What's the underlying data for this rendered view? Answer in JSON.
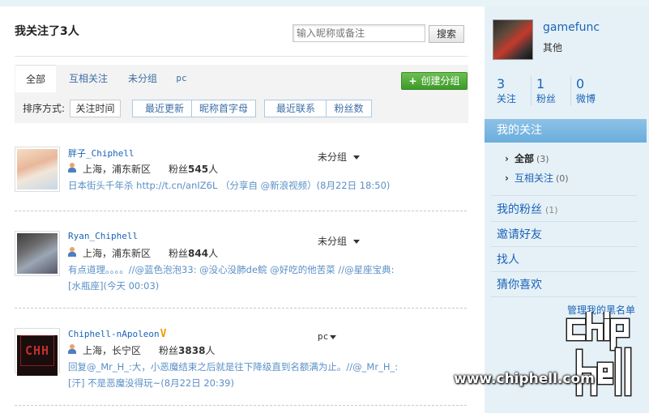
{
  "main": {
    "title": "我关注了3人",
    "search": {
      "placeholder": "输入昵称或备注",
      "button": "搜索"
    },
    "tabs": [
      {
        "label": "全部",
        "active": true
      },
      {
        "label": "互相关注"
      },
      {
        "label": "未分组"
      },
      {
        "label": "pc"
      }
    ],
    "create_group": "创建分组",
    "sort_label": "排序方式:",
    "sort_options": [
      "关注时间",
      "最近更新",
      "昵称首字母",
      "最近联系",
      "粉丝数"
    ],
    "users": [
      {
        "name": "胖子_Chiphell",
        "location": "上海，浦东新区",
        "fans_prefix": "粉丝",
        "fans_count": "545",
        "fans_suffix": "人",
        "group": "未分组",
        "status_line1": "日本街头千年杀 http://t.cn/anIZ6L （分享自 @新浪视频）(8月22日 18:50)",
        "status_line2": ""
      },
      {
        "name": "Ryan_Chiphell",
        "location": "上海，浦东新区",
        "fans_prefix": "粉丝",
        "fans_count": "844",
        "fans_suffix": "人",
        "group": "未分组",
        "status_line1": "有点道理。。。。//@蓝色泡泡33: @没心没肺de鲩 @好吃的他苦菜 //@星座宝典:",
        "status_line2": "[水瓶座](今天 00:03)"
      },
      {
        "name": "Chiphell-nApoleon",
        "verified": "V",
        "location": "上海，长宁区",
        "fans_prefix": "粉丝",
        "fans_count": "3838",
        "fans_suffix": "人",
        "group": "pc",
        "status_line1": "回复@_Mr_H_:大，小恶魔结束之后就是往下降级直到名额满为止。//@_Mr_H_:",
        "status_line2": "[汗] 不是恶魔没得玩~(8月22日 20:39)"
      }
    ],
    "avatar3_text": "CHH"
  },
  "sidebar": {
    "username": "gamefunc",
    "subtitle": "其他",
    "stats": [
      {
        "num": "3",
        "label": "关注"
      },
      {
        "num": "1",
        "label": "粉丝"
      },
      {
        "num": "0",
        "label": "微博"
      }
    ],
    "my_follow": "我的关注",
    "sub_items": [
      {
        "label": "全部",
        "count": "(3)",
        "active": true
      },
      {
        "label": "互相关注",
        "count": "(0)"
      }
    ],
    "links": [
      {
        "label": "我的粉丝",
        "count": "(1)"
      },
      {
        "label": "邀请好友"
      },
      {
        "label": "找人"
      },
      {
        "label": "猜你喜欢"
      }
    ],
    "blacklist": "管理我的黑名单"
  },
  "watermark": {
    "text": "www.chiphell.com"
  }
}
